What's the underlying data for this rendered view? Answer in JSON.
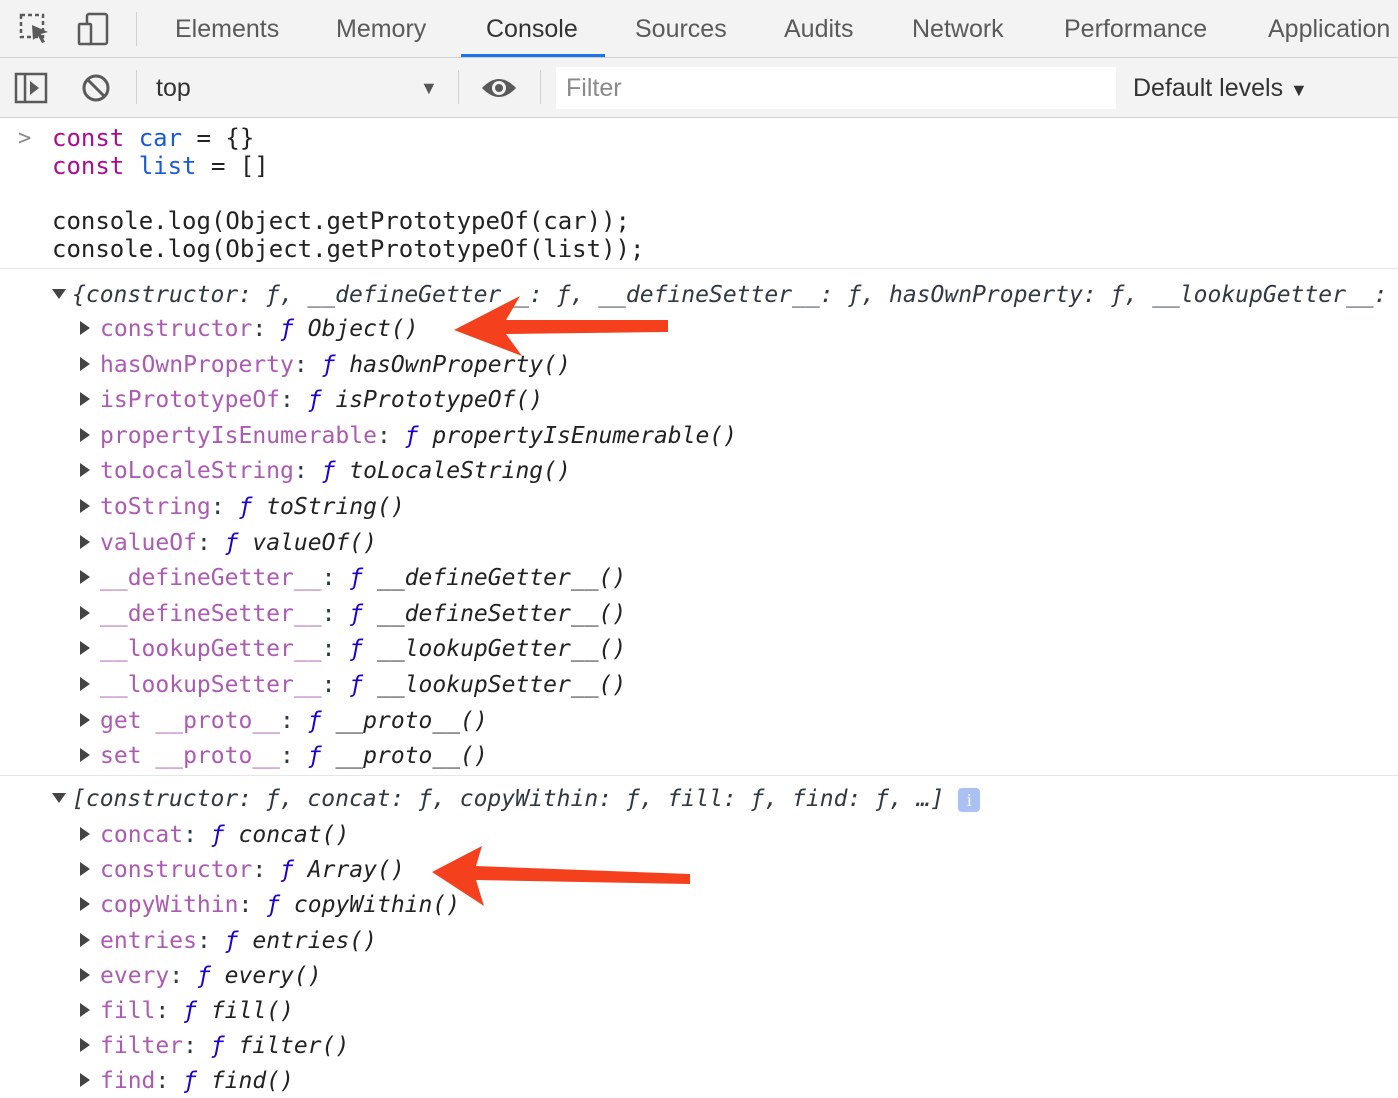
{
  "tabs": {
    "items": [
      "Elements",
      "Memory",
      "Console",
      "Sources",
      "Audits",
      "Network",
      "Performance",
      "Application"
    ],
    "active": "Console"
  },
  "toolbar": {
    "context": "top",
    "filter_placeholder": "Filter",
    "levels": "Default levels"
  },
  "input": {
    "lines": [
      {
        "kw": "const",
        "name": "car",
        "rest": " = {}"
      },
      {
        "kw": "const",
        "name": "list",
        "rest": " = []"
      }
    ],
    "log1": "console.log(Object.getPrototypeOf(car));",
    "log2": "console.log(Object.getPrototypeOf(list));"
  },
  "object_proto": {
    "summary": "{constructor: ƒ, __defineGetter__: ƒ, __defineSetter__: ƒ, hasOwnProperty: ƒ, __lookupGetter__: ƒ, …}",
    "props": [
      {
        "name": "constructor",
        "value": "Object()"
      },
      {
        "name": "hasOwnProperty",
        "value": "hasOwnProperty()"
      },
      {
        "name": "isPrototypeOf",
        "value": "isPrototypeOf()"
      },
      {
        "name": "propertyIsEnumerable",
        "value": "propertyIsEnumerable()"
      },
      {
        "name": "toLocaleString",
        "value": "toLocaleString()"
      },
      {
        "name": "toString",
        "value": "toString()"
      },
      {
        "name": "valueOf",
        "value": "valueOf()"
      },
      {
        "name": "__defineGetter__",
        "value": "__defineGetter__()"
      },
      {
        "name": "__defineSetter__",
        "value": "__defineSetter__()"
      },
      {
        "name": "__lookupGetter__",
        "value": "__lookupGetter__()"
      },
      {
        "name": "__lookupSetter__",
        "value": "__lookupSetter__()"
      },
      {
        "name": "get __proto__",
        "value": "__proto__()"
      },
      {
        "name": "set __proto__",
        "value": "__proto__()"
      }
    ]
  },
  "array_proto": {
    "summary": "[constructor: ƒ, concat: ƒ, copyWithin: ƒ, fill: ƒ, find: ƒ, …]",
    "info": "i",
    "props": [
      {
        "name": "concat",
        "value": "concat()"
      },
      {
        "name": "constructor",
        "value": "Array()"
      },
      {
        "name": "copyWithin",
        "value": "copyWithin()"
      },
      {
        "name": "entries",
        "value": "entries()"
      },
      {
        "name": "every",
        "value": "every()"
      },
      {
        "name": "fill",
        "value": "fill()"
      },
      {
        "name": "filter",
        "value": "filter()"
      },
      {
        "name": "find",
        "value": "find()"
      }
    ]
  },
  "func_symbol": "ƒ",
  "colors": {
    "accent": "#1a73e8",
    "arrow": "#f5401e",
    "prop_name": "#ab5bb1",
    "keyword": "#aa0d91"
  }
}
